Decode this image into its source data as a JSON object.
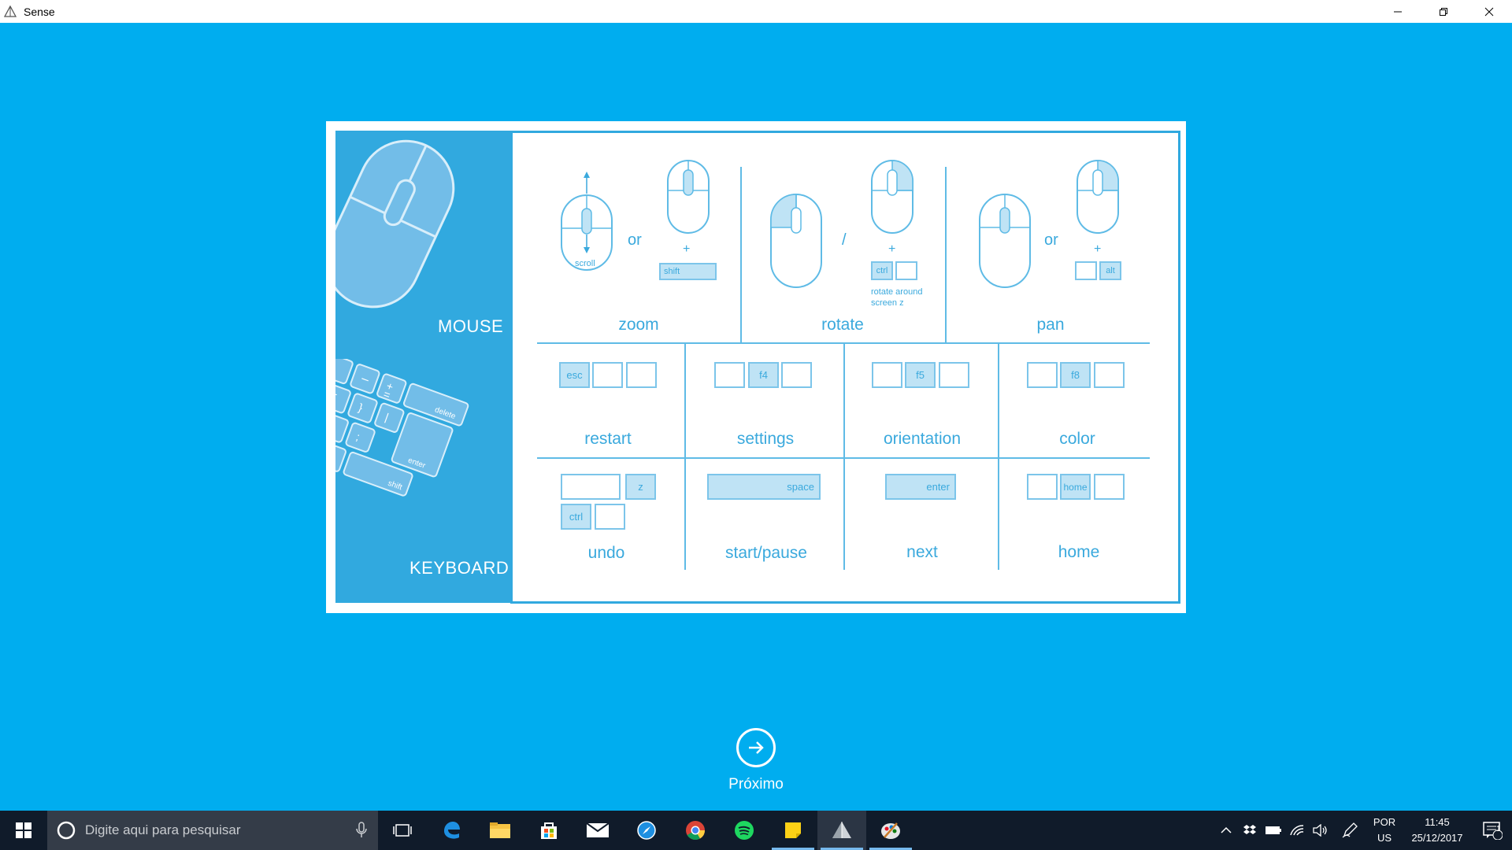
{
  "window": {
    "title": "Sense",
    "minimize_icon": "minimize-icon",
    "maximize_icon": "restore-icon",
    "close_icon": "close-icon"
  },
  "colors": {
    "background": "#00adef",
    "sidebar": "#31a9df",
    "accent_text": "#3aa9dd",
    "key_highlight": "#bfe3f5",
    "taskbar": "#101b2a"
  },
  "sidebar": {
    "mouse_label": "MOUSE",
    "keyboard_label": "KEYBOARD",
    "keyboard_keys": [
      "–",
      "+",
      "=",
      "delete",
      "{",
      "[",
      "}",
      "]",
      "|",
      "\\",
      ":",
      ";",
      "enter",
      "?",
      "/",
      "shift"
    ]
  },
  "mouse_controls": {
    "zoom": {
      "label": "zoom",
      "scroll_text": "scroll",
      "or": "or",
      "plus": "+",
      "key": "shift"
    },
    "rotate": {
      "label": "rotate",
      "separator": "/",
      "plus": "+",
      "key": "ctrl",
      "note": "rotate around\nscreen z"
    },
    "pan": {
      "label": "pan",
      "or": "or",
      "plus": "+",
      "key": "alt"
    }
  },
  "shortcuts": [
    {
      "label": "restart",
      "keys": [
        "esc",
        "",
        ""
      ]
    },
    {
      "label": "settings",
      "keys": [
        "",
        "f4",
        ""
      ]
    },
    {
      "label": "orientation",
      "keys": [
        "",
        "f5",
        ""
      ]
    },
    {
      "label": "color",
      "keys": [
        "",
        "f8",
        ""
      ]
    },
    {
      "label": "undo",
      "keys": [
        "",
        "z",
        "ctrl",
        ""
      ]
    },
    {
      "label": "start/pause",
      "keys": [
        "space"
      ]
    },
    {
      "label": "next",
      "keys": [
        "enter"
      ]
    },
    {
      "label": "home",
      "keys": [
        "",
        "home",
        ""
      ]
    }
  ],
  "next_button": {
    "label": "Próximo",
    "icon": "arrow-right-circle-icon"
  },
  "taskbar": {
    "search_placeholder": "Digite aqui para pesquisar",
    "apps": [
      "task-view-icon",
      "edge-icon",
      "file-explorer-icon",
      "store-icon",
      "mail-icon",
      "safari-like-icon",
      "chrome-icon",
      "spotify-icon",
      "sticky-notes-icon",
      "sense-app-icon",
      "paint-icon"
    ],
    "tray_icons": [
      "chevron-up-icon",
      "dropbox-icon",
      "battery-icon",
      "wifi-icon",
      "volume-icon",
      "pen-icon"
    ],
    "language": "POR",
    "keyboard_layout": "US",
    "time": "11:45",
    "date": "25/12/2017",
    "notification_count": "1"
  }
}
